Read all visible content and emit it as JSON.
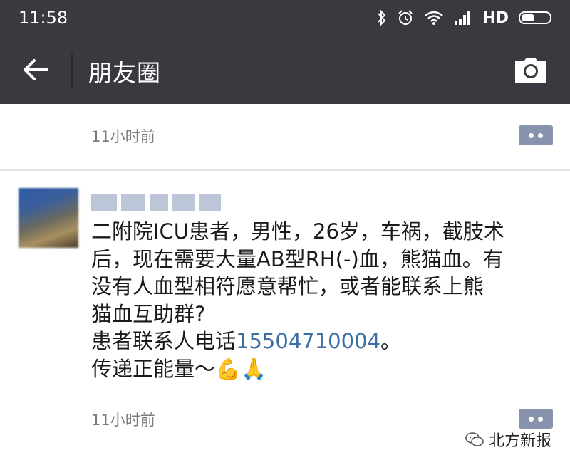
{
  "status_bar": {
    "time": "11:58",
    "network": "HD",
    "icons": [
      "bluetooth-icon",
      "alarm-icon",
      "wifi-icon",
      "signal-icon",
      "battery-icon"
    ]
  },
  "nav": {
    "title": "朋友圈",
    "back_icon": "back-arrow-icon",
    "camera_icon": "camera-icon"
  },
  "feed": {
    "previous_post_time": "11小时前",
    "post": {
      "text_line1": "二附院ICU患者，男性，26岁，车祸，截肢术",
      "text_line2": "后，现在需要大量AB型RH(-)血，熊猫血。有",
      "text_line3": "没有人血型相符愿意帮忙，或者能联系上熊",
      "text_line4": "猫血互助群?",
      "contact_prefix": "患者联系人电话",
      "phone": "15504710004",
      "contact_suffix": "。",
      "closing": "传递正能量～💪🙏",
      "time": "11小时前"
    }
  },
  "watermark": {
    "text": "北方新报"
  },
  "colors": {
    "header_bg": "#393a3f",
    "comment_button": "#8893ad",
    "link": "#3a6ea5"
  }
}
